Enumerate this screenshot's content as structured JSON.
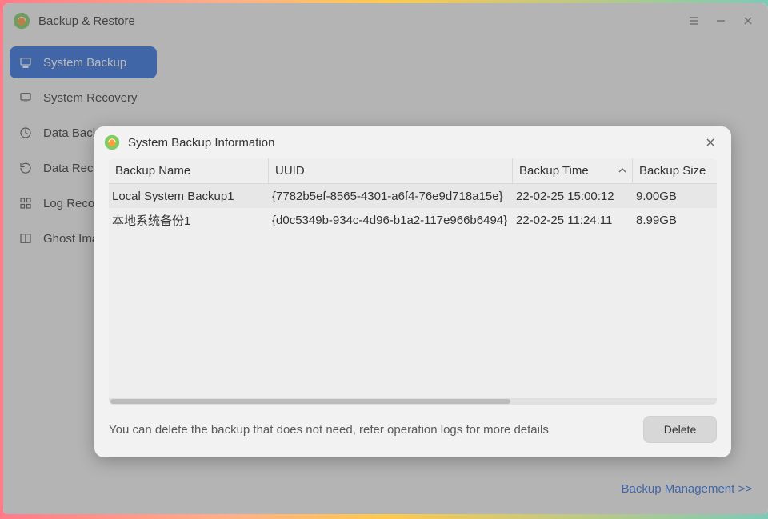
{
  "app": {
    "title": "Backup & Restore"
  },
  "sidebar": {
    "items": [
      {
        "label": "System Backup"
      },
      {
        "label": "System Recovery"
      },
      {
        "label": "Data Backup"
      },
      {
        "label": "Data Recovery"
      },
      {
        "label": "Log Records"
      },
      {
        "label": "Ghost Image"
      }
    ]
  },
  "main": {
    "managementLink": "Backup Management >>"
  },
  "dialog": {
    "title": "System Backup Information",
    "columns": {
      "name": "Backup Name",
      "uuid": "UUID",
      "time": "Backup Time",
      "size": "Backup Size"
    },
    "rows": [
      {
        "name": "Local System Backup1",
        "uuid": "{7782b5ef-8565-4301-a6f4-76e9d718a15e}",
        "time": "22-02-25 15:00:12",
        "size": "9.00GB"
      },
      {
        "name": "本地系统备份1",
        "uuid": "{d0c5349b-934c-4d96-b1a2-117e966b6494}",
        "time": "22-02-25 11:24:11",
        "size": "8.99GB"
      }
    ],
    "hint": "You can delete the backup that does not need, refer operation logs for more details",
    "deleteLabel": "Delete"
  }
}
